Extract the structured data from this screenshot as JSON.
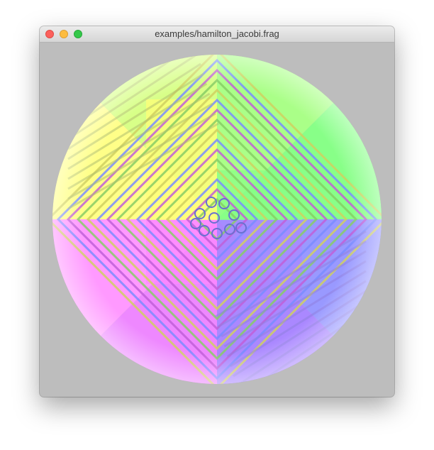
{
  "window": {
    "title": "examples/hamilton_jacobi.frag",
    "colors": {
      "background": "#bdbdbd",
      "close": "#fc605c",
      "minimize": "#fdbc40",
      "zoom": "#34c84a"
    }
  },
  "icons": {
    "close": "close-traffic-light-icon",
    "minimize": "minimize-traffic-light-icon",
    "zoom": "zoom-traffic-light-icon"
  },
  "render": {
    "palette": [
      "#ffff88",
      "#88ff88",
      "#ff88ff",
      "#8888ff"
    ]
  }
}
